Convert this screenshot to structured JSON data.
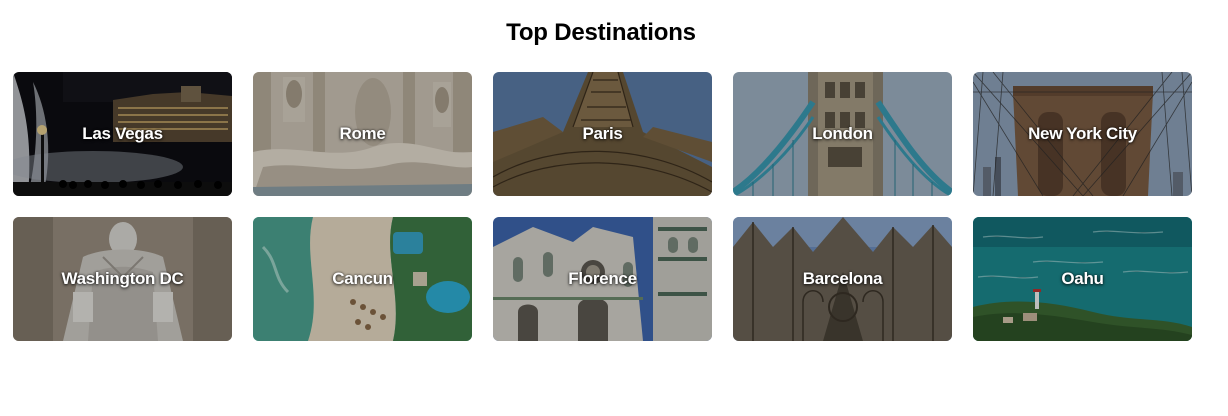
{
  "section": {
    "title": "Top Destinations"
  },
  "destinations": [
    {
      "name": "Las Vegas",
      "icon": "las-vegas-image"
    },
    {
      "name": "Rome",
      "icon": "rome-image"
    },
    {
      "name": "Paris",
      "icon": "paris-image"
    },
    {
      "name": "London",
      "icon": "london-image"
    },
    {
      "name": "New York City",
      "icon": "new-york-city-image"
    },
    {
      "name": "Washington DC",
      "icon": "washington-dc-image"
    },
    {
      "name": "Cancun",
      "icon": "cancun-image"
    },
    {
      "name": "Florence",
      "icon": "florence-image"
    },
    {
      "name": "Barcelona",
      "icon": "barcelona-image"
    },
    {
      "name": "Oahu",
      "icon": "oahu-image"
    }
  ]
}
